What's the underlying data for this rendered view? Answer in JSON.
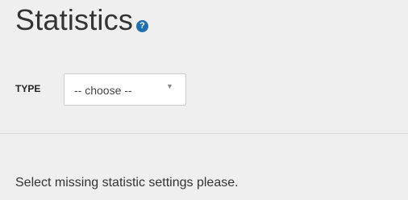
{
  "header": {
    "title": "Statistics",
    "help_icon_glyph": "?",
    "help_icon_name": "help-icon",
    "help_icon_color": "#1f6fb3"
  },
  "form": {
    "type_label": "TYPE",
    "type_select": {
      "selected_value": "-- choose --",
      "arrow_glyph": "▼"
    }
  },
  "status": {
    "message": "Select missing statistic settings please."
  }
}
